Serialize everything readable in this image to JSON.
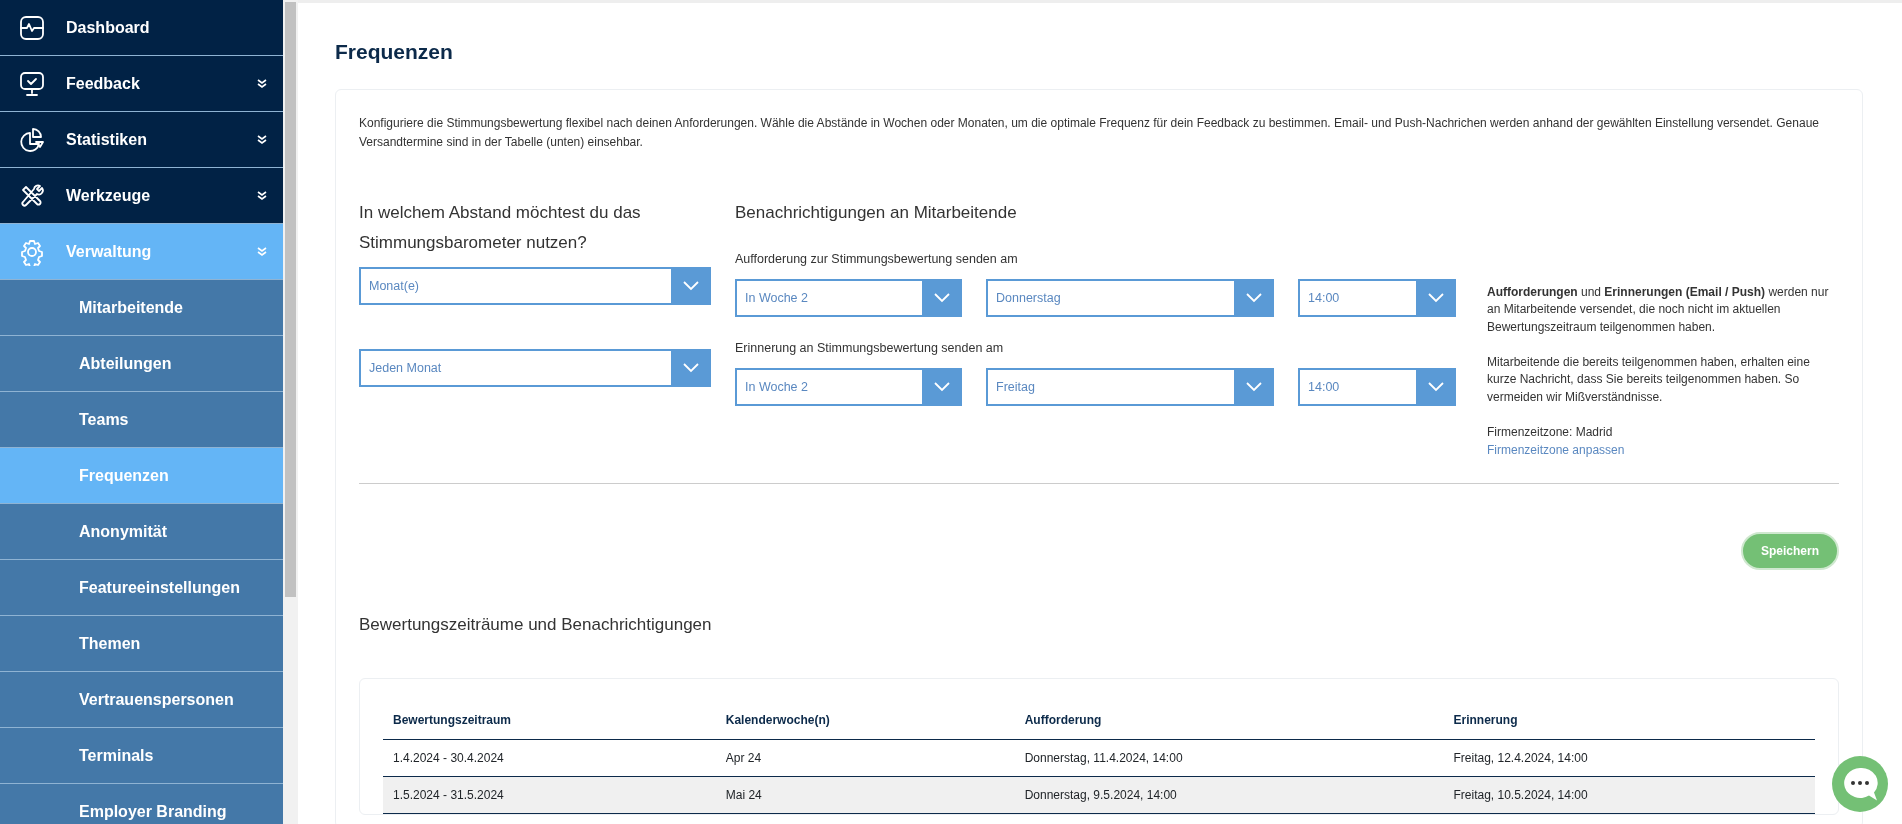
{
  "sidebar": {
    "items": [
      {
        "label": "Dashboard",
        "expandable": false,
        "selected": false
      },
      {
        "label": "Feedback",
        "expandable": true,
        "selected": false
      },
      {
        "label": "Statistiken",
        "expandable": true,
        "selected": false
      },
      {
        "label": "Werkzeuge",
        "expandable": true,
        "selected": false
      },
      {
        "label": "Verwaltung",
        "expandable": true,
        "selected": true,
        "children": [
          {
            "label": "Mitarbeitende",
            "selected": false
          },
          {
            "label": "Abteilungen",
            "selected": false
          },
          {
            "label": "Teams",
            "selected": false
          },
          {
            "label": "Frequenzen",
            "selected": true
          },
          {
            "label": "Anonymität",
            "selected": false
          },
          {
            "label": "Featureeinstellungen",
            "selected": false
          },
          {
            "label": "Themen",
            "selected": false
          },
          {
            "label": "Vertrauenspersonen",
            "selected": false
          },
          {
            "label": "Terminals",
            "selected": false
          },
          {
            "label": "Employer Branding",
            "selected": false
          }
        ]
      }
    ]
  },
  "page_title": "Frequenzen",
  "description": "Konfiguriere die Stimmungsbewertung flexibel nach deinen Anforderungen. Wähle die Abstände in Wochen oder Monaten, um die optimale Frequenz für dein Feedback zu bestimmen. Email- und Push-Nachrichen werden anhand der gewählten Einstellung versendet. Genaue Versandtermine sind in der Tabelle (unten) einsehbar.",
  "interval": {
    "heading": "In welchem Abstand möchtest du das Stimmungsbarometer nutzen?",
    "selects": [
      {
        "value": "Monat(e)"
      },
      {
        "value": "Jeden Monat"
      }
    ]
  },
  "notifications": {
    "heading": "Benachrichtigungen an Mitarbeitende",
    "groups": [
      {
        "label": "Aufforderung zur Stimmungsbewertung senden am",
        "selects": [
          {
            "value": "In Woche 2"
          },
          {
            "value": "Donnerstag"
          },
          {
            "value": "14:00"
          }
        ]
      },
      {
        "label": "Erinnerung an Stimmungsbewertung senden am",
        "selects": [
          {
            "value": "In Woche 2"
          },
          {
            "value": "Freitag"
          },
          {
            "value": "14:00"
          }
        ]
      }
    ]
  },
  "info": {
    "paragraphs": [
      "**Aufforderungen** und **Erinnerungen (Email / Push)** werden nur an Mitarbeitende versendet, die noch nicht im aktuellen Bewertungszeitraum teilgenommen haben.",
      "Mitarbeitende die bereits teilgenommen haben, erhalten eine kurze Nachricht, dass Sie bereits teilgenommen haben. So vermeiden wir Mißverständnisse."
    ],
    "timezone": "Firmenzeitzone: Madrid",
    "timezone_link": "Firmenzeitzone anpassen"
  },
  "save_button": "Speichern",
  "schedule": {
    "heading": "Bewertungszeiträume und Benachrichtigungen",
    "table": {
      "columns": [
        "Bewertungszeitraum",
        "Kalenderwoche(n)",
        "Aufforderung",
        "Erinnerung"
      ],
      "rows": [
        [
          "1.4.2024 - 30.4.2024",
          "Apr 24",
          "Donnerstag, 11.4.2024, 14:00",
          "Freitag, 12.4.2024, 14:00"
        ],
        [
          "1.5.2024 - 31.5.2024",
          "Mai 24",
          "Donnerstag, 9.5.2024, 14:00",
          "Freitag, 10.5.2024, 14:00"
        ]
      ]
    }
  }
}
